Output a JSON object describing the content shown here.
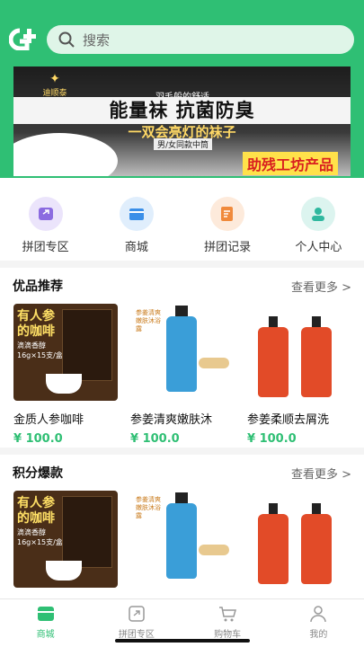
{
  "search": {
    "placeholder": "搜索"
  },
  "banner": {
    "brand": "迪顺泰",
    "tag1": "羽毛般的舒适",
    "title": "能量袜  抗菌防臭",
    "subtitle": "一双会亮灯的袜子",
    "tag2": "男/女同款中筒",
    "factory": "助残工坊产品"
  },
  "nav": [
    {
      "label": "拼团专区",
      "icon": "group-buy-icon",
      "color": "#ebe4fb",
      "iconColor": "#8b6be0"
    },
    {
      "label": "商城",
      "icon": "store-icon",
      "color": "#e0eefc",
      "iconColor": "#3b8fe8"
    },
    {
      "label": "拼团记录",
      "icon": "record-icon",
      "color": "#fdeadb",
      "iconColor": "#f08a3c"
    },
    {
      "label": "个人中心",
      "icon": "user-icon",
      "color": "#dcf4ef",
      "iconColor": "#2fb89f"
    }
  ],
  "sections": [
    {
      "title": "优品推荐",
      "more": "查看更多 >",
      "products": [
        {
          "name": "金质人参咖啡",
          "price": "¥ 100.0",
          "kind": "coffee"
        },
        {
          "name": "参姜清爽嫩肤沐",
          "price": "¥ 100.0",
          "kind": "gel"
        },
        {
          "name": "参姜柔顺去屑洗",
          "price": "¥ 100.0",
          "kind": "sham"
        }
      ]
    },
    {
      "title": "积分爆款",
      "more": "查看更多 >",
      "products": [
        {
          "name": "",
          "price": "",
          "kind": "coffee"
        },
        {
          "name": "",
          "price": "",
          "kind": "gel"
        },
        {
          "name": "",
          "price": "",
          "kind": "sham"
        }
      ]
    }
  ],
  "coffee_pack": {
    "line1": "有人参",
    "line2": "的咖啡",
    "line3": "滴滴香醇",
    "line4": "16g×15支/盒"
  },
  "gel_label": "参姜清爽嫩肤沐浴露",
  "tabs": [
    {
      "label": "商城",
      "active": true
    },
    {
      "label": "拼团专区",
      "active": false
    },
    {
      "label": "购物车",
      "active": false
    },
    {
      "label": "我的",
      "active": false
    }
  ],
  "colors": {
    "brand": "#2fbf74",
    "price": "#2fbf74"
  }
}
